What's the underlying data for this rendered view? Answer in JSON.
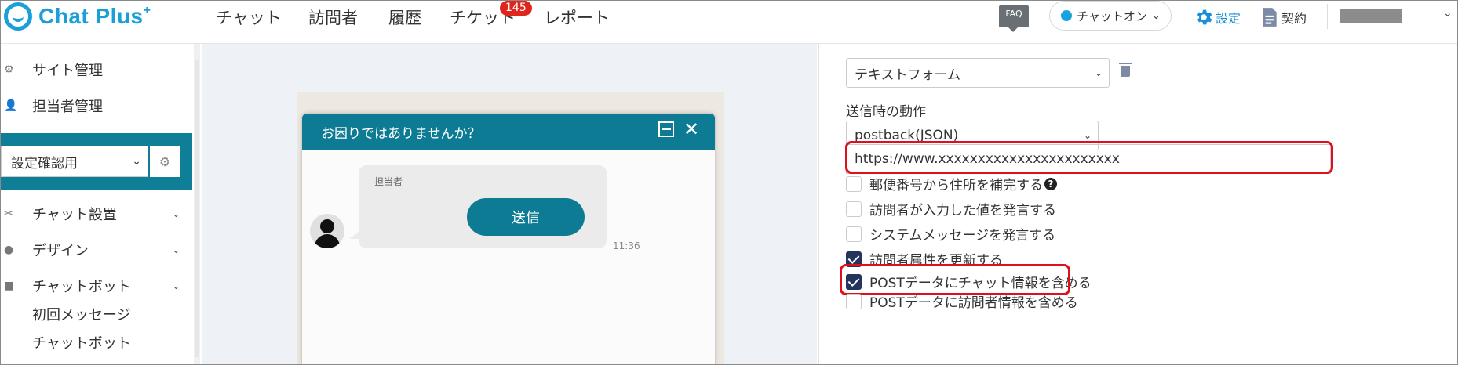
{
  "brand": {
    "name": "Chat Plus",
    "plus": "+"
  },
  "nav": {
    "items": [
      "チャット",
      "訪問者",
      "履歴",
      "チケット",
      "レポート"
    ],
    "ticket_badge": "145"
  },
  "header": {
    "faq": "FAQ",
    "status": "チャットオン",
    "settings": "設定",
    "contract": "契約"
  },
  "sidebar": {
    "site_management": "サイト管理",
    "staff_management": "担当者管理",
    "site_select": "設定確認用",
    "chat_setup": "チャット設置",
    "design": "デザイン",
    "chatbot": "チャットボット",
    "sub_items": [
      "初回メッセージ",
      "チャットボット"
    ]
  },
  "preview": {
    "title": "お困りではありませんか？",
    "agent_label": "担当者",
    "button_label": "送信",
    "time": "11:36"
  },
  "form": {
    "field_type": "テキストフォーム",
    "on_submit_label": "送信時の動作",
    "on_submit_value": "postback(JSON)",
    "url": "https://www.xxxxxxxxxxxxxxxxxxxxxxx",
    "checkboxes": [
      {
        "label": "郵便番号から住所を補完する",
        "checked": false
      },
      {
        "label": "訪問者が入力した値を発言する",
        "checked": false
      },
      {
        "label": "システムメッセージを発言する",
        "checked": false
      },
      {
        "label": "訪問者属性を更新する",
        "checked": true
      },
      {
        "label": "POSTデータにチャット情報を含める",
        "checked": true
      },
      {
        "label": "POSTデータに訪問者情報を含める",
        "checked": false
      }
    ],
    "help_glyph": "?"
  },
  "colors": {
    "accent": "#0d7b93",
    "brand": "#1a9fd9",
    "highlight": "#e0101a",
    "checkbox": "#24345c"
  }
}
